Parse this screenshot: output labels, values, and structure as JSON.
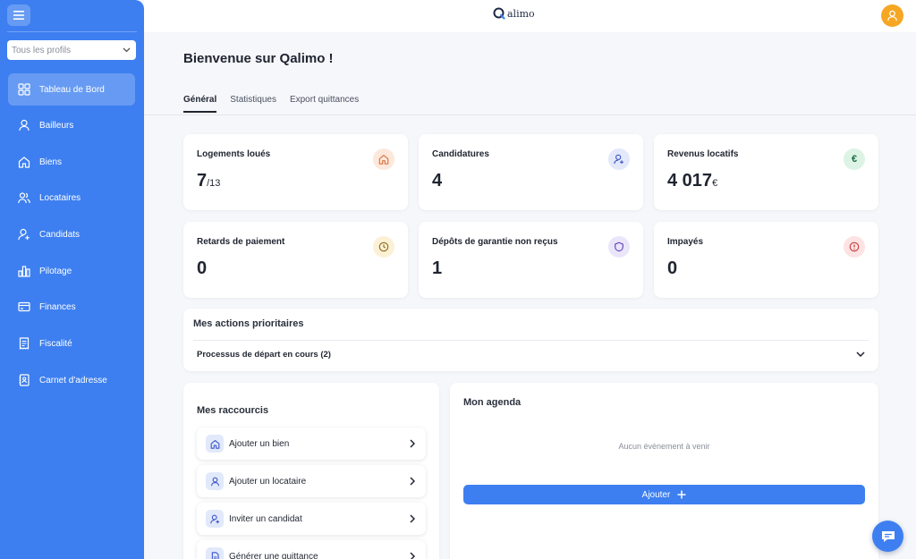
{
  "app": {
    "logo_text": "alimo"
  },
  "sidebar": {
    "profile_select": "Tous les profils",
    "items": [
      {
        "label": "Tableau de Bord",
        "icon": "dashboard-icon",
        "active": true
      },
      {
        "label": "Bailleurs",
        "icon": "user-icon"
      },
      {
        "label": "Biens",
        "icon": "home-icon"
      },
      {
        "label": "Locataires",
        "icon": "users-icon"
      },
      {
        "label": "Candidats",
        "icon": "user-plus-icon"
      },
      {
        "label": "Pilotage",
        "icon": "bar-chart-icon"
      },
      {
        "label": "Finances",
        "icon": "credit-card-icon"
      },
      {
        "label": "Fiscalité",
        "icon": "receipt-icon"
      },
      {
        "label": "Carnet d'adresse",
        "icon": "address-book-icon"
      }
    ]
  },
  "header": {
    "title": "Bienvenue sur Qalimo !",
    "tabs": [
      {
        "label": "Général",
        "active": true
      },
      {
        "label": "Statistiques"
      },
      {
        "label": "Export quittances"
      }
    ]
  },
  "kpis": [
    {
      "label": "Logements loués",
      "value": "7",
      "suffix": "/13",
      "icon": "home-icon",
      "color": "#fde8dc"
    },
    {
      "label": "Candidatures",
      "value": "4",
      "suffix": "",
      "icon": "user-plus-icon",
      "color": "#e3e8fb"
    },
    {
      "label": "Revenus locatifs",
      "value": "4 017",
      "suffix": "€",
      "icon": "euro-icon",
      "color": "#dcf3e6"
    },
    {
      "label": "Retards de paiement",
      "value": "0",
      "suffix": "",
      "icon": "clock-icon",
      "color": "#fcf1d6"
    },
    {
      "label": "Dépôts de garantie non reçus",
      "value": "1",
      "suffix": "",
      "icon": "shield-icon",
      "color": "#ebe5fa"
    },
    {
      "label": "Impayés",
      "value": "0",
      "suffix": "",
      "icon": "alert-icon",
      "color": "#fde3e3"
    }
  ],
  "actions": {
    "title": "Mes actions prioritaires",
    "rows": [
      {
        "label": "Processus de départ en cours (2)"
      }
    ]
  },
  "shortcuts": {
    "title": "Mes raccourcis",
    "items": [
      {
        "label": "Ajouter un bien",
        "icon": "home-icon"
      },
      {
        "label": "Ajouter un locataire",
        "icon": "user-icon"
      },
      {
        "label": "Inviter un candidat",
        "icon": "user-plus-icon"
      },
      {
        "label": "Générer une quittance",
        "icon": "document-icon"
      }
    ]
  },
  "agenda": {
    "title": "Mon agenda",
    "empty_text": "Aucun évènement à venir",
    "add_label": "Ajouter"
  }
}
